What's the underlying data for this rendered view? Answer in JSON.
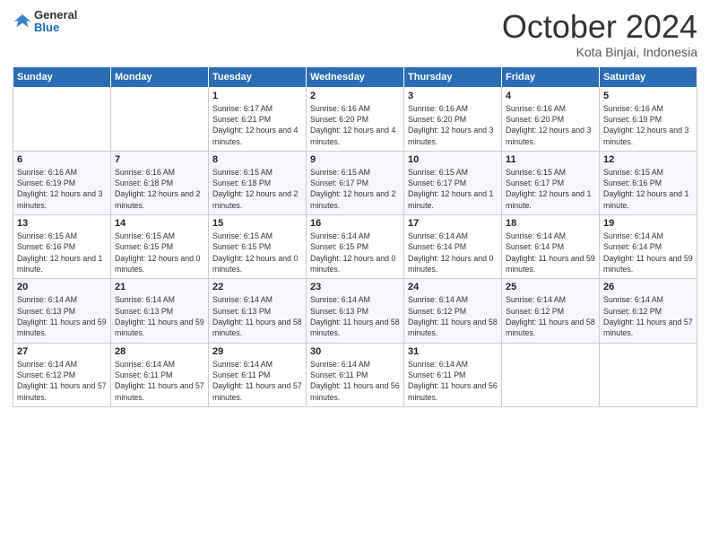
{
  "header": {
    "logo": {
      "general": "General",
      "blue": "Blue"
    },
    "title": "October 2024",
    "location": "Kota Binjai, Indonesia"
  },
  "days_of_week": [
    "Sunday",
    "Monday",
    "Tuesday",
    "Wednesday",
    "Thursday",
    "Friday",
    "Saturday"
  ],
  "weeks": [
    [
      {
        "day": "",
        "info": ""
      },
      {
        "day": "",
        "info": ""
      },
      {
        "day": "1",
        "sunrise": "6:17 AM",
        "sunset": "6:21 PM",
        "daylight": "12 hours and 4 minutes."
      },
      {
        "day": "2",
        "sunrise": "6:16 AM",
        "sunset": "6:20 PM",
        "daylight": "12 hours and 4 minutes."
      },
      {
        "day": "3",
        "sunrise": "6:16 AM",
        "sunset": "6:20 PM",
        "daylight": "12 hours and 3 minutes."
      },
      {
        "day": "4",
        "sunrise": "6:16 AM",
        "sunset": "6:20 PM",
        "daylight": "12 hours and 3 minutes."
      },
      {
        "day": "5",
        "sunrise": "6:16 AM",
        "sunset": "6:19 PM",
        "daylight": "12 hours and 3 minutes."
      }
    ],
    [
      {
        "day": "6",
        "sunrise": "6:16 AM",
        "sunset": "6:19 PM",
        "daylight": "12 hours and 3 minutes."
      },
      {
        "day": "7",
        "sunrise": "6:16 AM",
        "sunset": "6:18 PM",
        "daylight": "12 hours and 2 minutes."
      },
      {
        "day": "8",
        "sunrise": "6:15 AM",
        "sunset": "6:18 PM",
        "daylight": "12 hours and 2 minutes."
      },
      {
        "day": "9",
        "sunrise": "6:15 AM",
        "sunset": "6:17 PM",
        "daylight": "12 hours and 2 minutes."
      },
      {
        "day": "10",
        "sunrise": "6:15 AM",
        "sunset": "6:17 PM",
        "daylight": "12 hours and 1 minute."
      },
      {
        "day": "11",
        "sunrise": "6:15 AM",
        "sunset": "6:17 PM",
        "daylight": "12 hours and 1 minute."
      },
      {
        "day": "12",
        "sunrise": "6:15 AM",
        "sunset": "6:16 PM",
        "daylight": "12 hours and 1 minute."
      }
    ],
    [
      {
        "day": "13",
        "sunrise": "6:15 AM",
        "sunset": "6:16 PM",
        "daylight": "12 hours and 1 minute."
      },
      {
        "day": "14",
        "sunrise": "6:15 AM",
        "sunset": "6:15 PM",
        "daylight": "12 hours and 0 minutes."
      },
      {
        "day": "15",
        "sunrise": "6:15 AM",
        "sunset": "6:15 PM",
        "daylight": "12 hours and 0 minutes."
      },
      {
        "day": "16",
        "sunrise": "6:14 AM",
        "sunset": "6:15 PM",
        "daylight": "12 hours and 0 minutes."
      },
      {
        "day": "17",
        "sunrise": "6:14 AM",
        "sunset": "6:14 PM",
        "daylight": "12 hours and 0 minutes."
      },
      {
        "day": "18",
        "sunrise": "6:14 AM",
        "sunset": "6:14 PM",
        "daylight": "11 hours and 59 minutes."
      },
      {
        "day": "19",
        "sunrise": "6:14 AM",
        "sunset": "6:14 PM",
        "daylight": "11 hours and 59 minutes."
      }
    ],
    [
      {
        "day": "20",
        "sunrise": "6:14 AM",
        "sunset": "6:13 PM",
        "daylight": "11 hours and 59 minutes."
      },
      {
        "day": "21",
        "sunrise": "6:14 AM",
        "sunset": "6:13 PM",
        "daylight": "11 hours and 59 minutes."
      },
      {
        "day": "22",
        "sunrise": "6:14 AM",
        "sunset": "6:13 PM",
        "daylight": "11 hours and 58 minutes."
      },
      {
        "day": "23",
        "sunrise": "6:14 AM",
        "sunset": "6:13 PM",
        "daylight": "11 hours and 58 minutes."
      },
      {
        "day": "24",
        "sunrise": "6:14 AM",
        "sunset": "6:12 PM",
        "daylight": "11 hours and 58 minutes."
      },
      {
        "day": "25",
        "sunrise": "6:14 AM",
        "sunset": "6:12 PM",
        "daylight": "11 hours and 58 minutes."
      },
      {
        "day": "26",
        "sunrise": "6:14 AM",
        "sunset": "6:12 PM",
        "daylight": "11 hours and 57 minutes."
      }
    ],
    [
      {
        "day": "27",
        "sunrise": "6:14 AM",
        "sunset": "6:12 PM",
        "daylight": "11 hours and 57 minutes."
      },
      {
        "day": "28",
        "sunrise": "6:14 AM",
        "sunset": "6:11 PM",
        "daylight": "11 hours and 57 minutes."
      },
      {
        "day": "29",
        "sunrise": "6:14 AM",
        "sunset": "6:11 PM",
        "daylight": "11 hours and 57 minutes."
      },
      {
        "day": "30",
        "sunrise": "6:14 AM",
        "sunset": "6:11 PM",
        "daylight": "11 hours and 56 minutes."
      },
      {
        "day": "31",
        "sunrise": "6:14 AM",
        "sunset": "6:11 PM",
        "daylight": "11 hours and 56 minutes."
      },
      {
        "day": "",
        "info": ""
      },
      {
        "day": "",
        "info": ""
      }
    ]
  ]
}
